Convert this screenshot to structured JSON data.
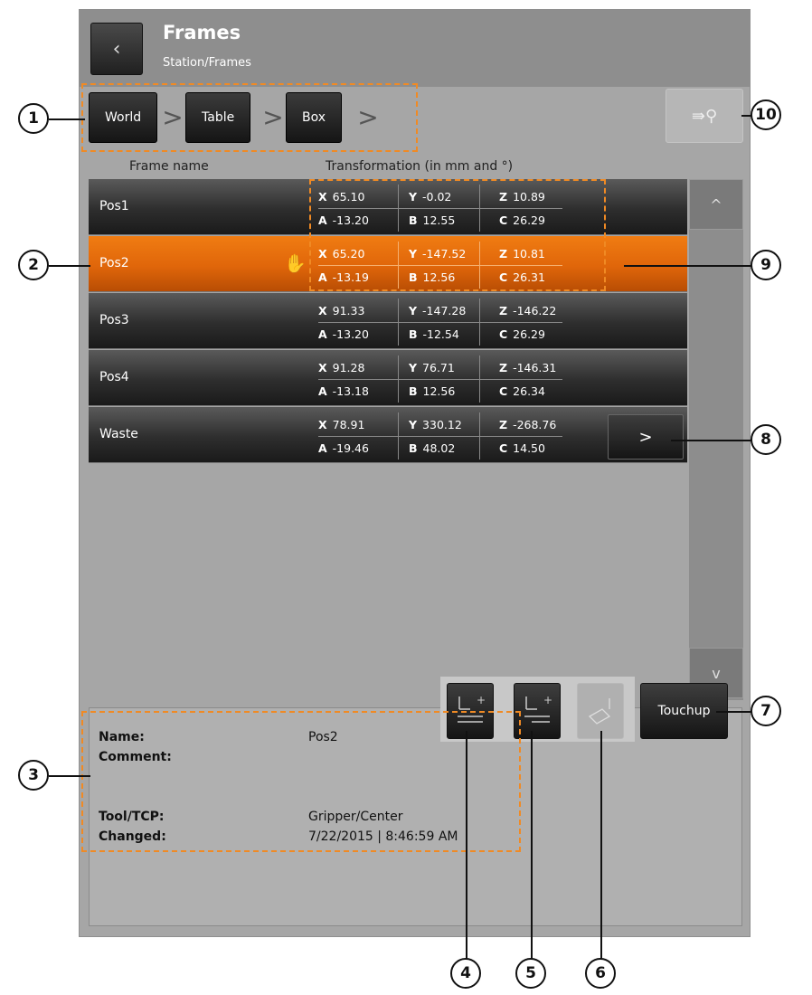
{
  "header": {
    "back_label": "‹",
    "title": "Frames",
    "subtitle": "Station/Frames"
  },
  "breadcrumb": {
    "items": [
      "World",
      "Table",
      "Box"
    ],
    "separator": ">"
  },
  "search_button": {
    "icon": "teach-search-icon",
    "glyph": "⇛⚲"
  },
  "columns": {
    "name": "Frame name",
    "transform": "Transformation (in mm and °)"
  },
  "frames": [
    {
      "name": "Pos1",
      "x": "65.10",
      "y": "-0.02",
      "z": "10.89",
      "a": "-13.20",
      "b": "12.55",
      "c": "26.29"
    },
    {
      "name": "Pos2",
      "x": "65.20",
      "y": "-147.52",
      "z": "10.81",
      "a": "-13.19",
      "b": "12.56",
      "c": "26.31"
    },
    {
      "name": "Pos3",
      "x": "91.33",
      "y": "-147.28",
      "z": "-146.22",
      "a": "-13.20",
      "b": "-12.54",
      "c": "26.29"
    },
    {
      "name": "Pos4",
      "x": "91.28",
      "y": "76.71",
      "z": "-146.31",
      "a": "-13.18",
      "b": "12.56",
      "c": "26.34"
    },
    {
      "name": "Waste",
      "x": "78.91",
      "y": "330.12",
      "z": "-268.76",
      "a": "-19.46",
      "b": "48.02",
      "c": "14.50"
    }
  ],
  "axis_labels": {
    "x": "X",
    "y": "Y",
    "z": "Z",
    "a": "A",
    "b": "B",
    "c": "C"
  },
  "selected_frame": "Pos2",
  "open_glyph": ">",
  "scroll": {
    "up": "^",
    "down": "v"
  },
  "details": {
    "name_label": "Name:",
    "name_value": "Pos2",
    "comment_label": "Comment:",
    "comment_value": "",
    "tool_label": "Tool/TCP:",
    "tool_value": "Gripper/Center",
    "changed_label": "Changed:",
    "changed_value": "7/22/2015 | 8:46:59 AM"
  },
  "toolbar": {
    "touchup_label": "Touchup",
    "add_glyph": "+"
  },
  "callouts": [
    "1",
    "2",
    "3",
    "4",
    "5",
    "6",
    "7",
    "8",
    "9",
    "10"
  ],
  "colors": {
    "accent": "#e8700c",
    "header": "#8e8e8e",
    "panel": "#a6a6a6",
    "callout_frame": "#f08a24"
  }
}
